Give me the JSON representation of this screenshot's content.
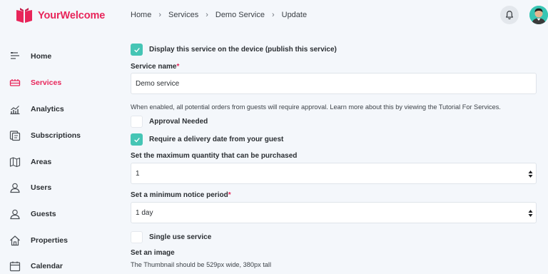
{
  "brand": {
    "name": "YourWelcome",
    "color": "#e8255a"
  },
  "breadcrumb": [
    "Home",
    "Services",
    "Demo Service",
    "Update"
  ],
  "header": {
    "bell_icon": "bell-icon",
    "avatar_icon": "avatar"
  },
  "sidebar": {
    "items": [
      {
        "label": "Home",
        "icon": "home-icon",
        "active": false
      },
      {
        "label": "Services",
        "icon": "services-icon",
        "active": true
      },
      {
        "label": "Analytics",
        "icon": "analytics-icon",
        "active": false
      },
      {
        "label": "Subscriptions",
        "icon": "subscriptions-icon",
        "active": false
      },
      {
        "label": "Areas",
        "icon": "map-icon",
        "active": false
      },
      {
        "label": "Users",
        "icon": "user-icon",
        "active": false
      },
      {
        "label": "Guests",
        "icon": "guest-icon",
        "active": false
      },
      {
        "label": "Properties",
        "icon": "house-icon",
        "active": false
      },
      {
        "label": "Calendar",
        "icon": "calendar-icon",
        "active": false
      }
    ]
  },
  "form": {
    "publish": {
      "label": "Display this service on the device (publish this service)",
      "checked": true
    },
    "service_name": {
      "label": "Service name",
      "value": "Demo service"
    },
    "approval_help": "When enabled, all potential orders from guests will require approval. Learn more about this by viewing the Tutorial For Services.",
    "approval": {
      "label": "Approval Needed",
      "checked": false
    },
    "delivery": {
      "label": "Require a delivery date from your guest",
      "checked": true
    },
    "max_quantity": {
      "label": "Set the maximum quantity that can be purchased",
      "value": "1"
    },
    "notice": {
      "label": "Set a minimum notice period",
      "value": "1 day"
    },
    "single_use": {
      "label": "Single use service",
      "checked": false
    },
    "image": {
      "label": "Set an image",
      "help": "The Thumbnail should be 529px wide, 380px tall"
    },
    "required_mark": "*"
  },
  "colors": {
    "accent": "#e8255a",
    "check": "#45c5b5",
    "background": "#f4f7fb"
  }
}
